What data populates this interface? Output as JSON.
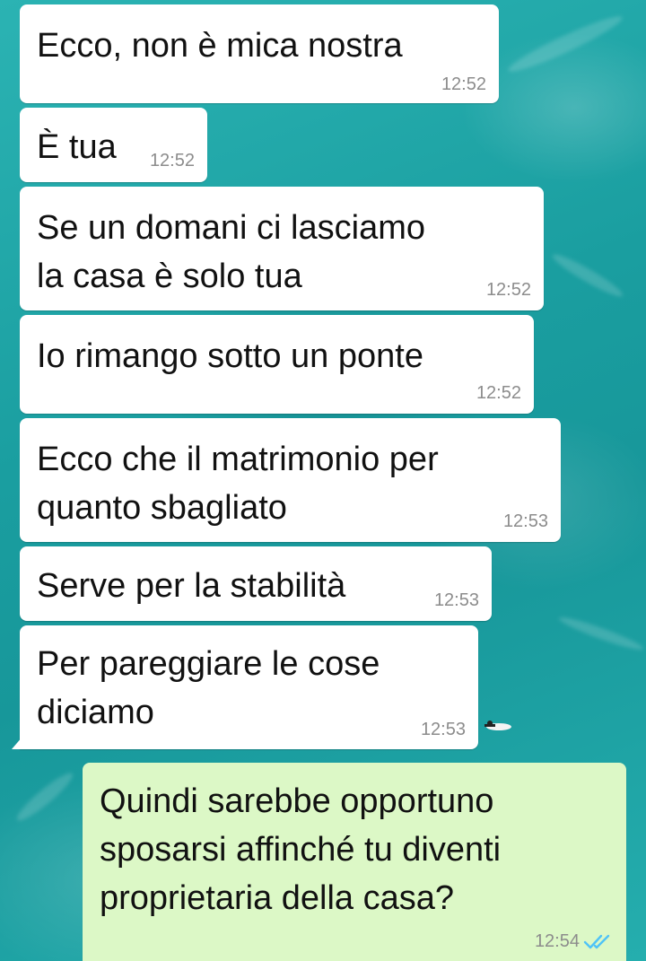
{
  "chat": {
    "messages": [
      {
        "direction": "in",
        "lines": [
          "Ecco, non è mica nostra"
        ],
        "time": "12:52"
      },
      {
        "direction": "in",
        "lines": [
          "È tua"
        ],
        "time": "12:52"
      },
      {
        "direction": "in",
        "lines": [
          "Se un domani ci lasciamo",
          "la casa è solo tua"
        ],
        "time": "12:52"
      },
      {
        "direction": "in",
        "lines": [
          "Io rimango sotto un ponte"
        ],
        "time": "12:52"
      },
      {
        "direction": "in",
        "lines": [
          "Ecco che il matrimonio per",
          "quanto sbagliato"
        ],
        "time": "12:53"
      },
      {
        "direction": "in",
        "lines": [
          "Serve per la stabilità"
        ],
        "time": "12:53"
      },
      {
        "direction": "in",
        "lines": [
          "Per pareggiare le cose",
          "diciamo"
        ],
        "time": "12:53"
      },
      {
        "direction": "out",
        "lines": [
          "Quindi sarebbe opportuno",
          "sposarsi affinché tu diventi",
          "proprietaria della casa?"
        ],
        "time": "12:54",
        "status": "read"
      }
    ]
  },
  "theme": {
    "incoming_bubble": "#ffffff",
    "outgoing_bubble": "#dcf8c6",
    "timestamp_color": "#8c8c8c",
    "read_ticks_color": "#4fc3f7",
    "wallpaper": "#1fa5a6"
  },
  "icons": {
    "read_receipt": "double-check-icon"
  }
}
